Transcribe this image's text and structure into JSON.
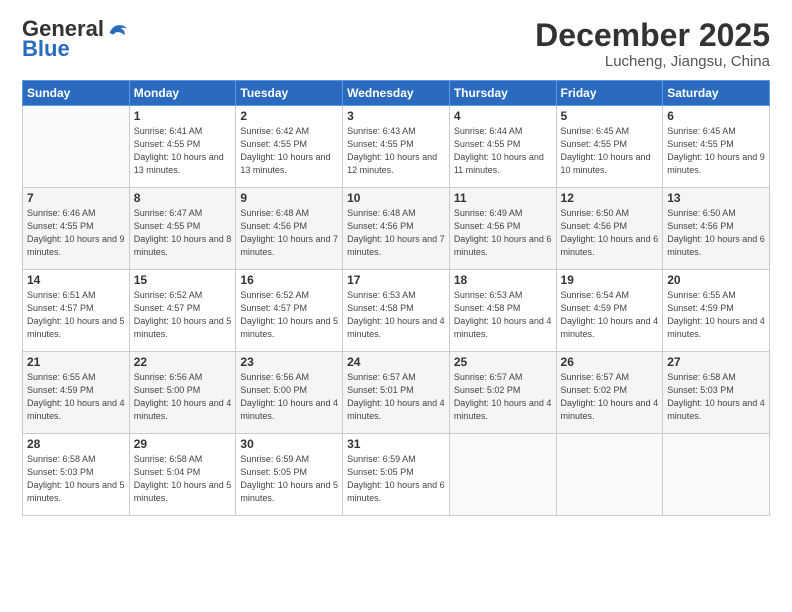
{
  "logo": {
    "general": "General",
    "blue": "Blue"
  },
  "title": "December 2025",
  "location": "Lucheng, Jiangsu, China",
  "weekdays": [
    "Sunday",
    "Monday",
    "Tuesday",
    "Wednesday",
    "Thursday",
    "Friday",
    "Saturday"
  ],
  "weeks": [
    [
      {
        "num": "",
        "sunrise": "",
        "sunset": "",
        "daylight": "",
        "empty": true
      },
      {
        "num": "1",
        "sunrise": "Sunrise: 6:41 AM",
        "sunset": "Sunset: 4:55 PM",
        "daylight": "Daylight: 10 hours and 13 minutes."
      },
      {
        "num": "2",
        "sunrise": "Sunrise: 6:42 AM",
        "sunset": "Sunset: 4:55 PM",
        "daylight": "Daylight: 10 hours and 13 minutes."
      },
      {
        "num": "3",
        "sunrise": "Sunrise: 6:43 AM",
        "sunset": "Sunset: 4:55 PM",
        "daylight": "Daylight: 10 hours and 12 minutes."
      },
      {
        "num": "4",
        "sunrise": "Sunrise: 6:44 AM",
        "sunset": "Sunset: 4:55 PM",
        "daylight": "Daylight: 10 hours and 11 minutes."
      },
      {
        "num": "5",
        "sunrise": "Sunrise: 6:45 AM",
        "sunset": "Sunset: 4:55 PM",
        "daylight": "Daylight: 10 hours and 10 minutes."
      },
      {
        "num": "6",
        "sunrise": "Sunrise: 6:45 AM",
        "sunset": "Sunset: 4:55 PM",
        "daylight": "Daylight: 10 hours and 9 minutes."
      }
    ],
    [
      {
        "num": "7",
        "sunrise": "Sunrise: 6:46 AM",
        "sunset": "Sunset: 4:55 PM",
        "daylight": "Daylight: 10 hours and 9 minutes."
      },
      {
        "num": "8",
        "sunrise": "Sunrise: 6:47 AM",
        "sunset": "Sunset: 4:55 PM",
        "daylight": "Daylight: 10 hours and 8 minutes."
      },
      {
        "num": "9",
        "sunrise": "Sunrise: 6:48 AM",
        "sunset": "Sunset: 4:56 PM",
        "daylight": "Daylight: 10 hours and 7 minutes."
      },
      {
        "num": "10",
        "sunrise": "Sunrise: 6:48 AM",
        "sunset": "Sunset: 4:56 PM",
        "daylight": "Daylight: 10 hours and 7 minutes."
      },
      {
        "num": "11",
        "sunrise": "Sunrise: 6:49 AM",
        "sunset": "Sunset: 4:56 PM",
        "daylight": "Daylight: 10 hours and 6 minutes."
      },
      {
        "num": "12",
        "sunrise": "Sunrise: 6:50 AM",
        "sunset": "Sunset: 4:56 PM",
        "daylight": "Daylight: 10 hours and 6 minutes."
      },
      {
        "num": "13",
        "sunrise": "Sunrise: 6:50 AM",
        "sunset": "Sunset: 4:56 PM",
        "daylight": "Daylight: 10 hours and 6 minutes."
      }
    ],
    [
      {
        "num": "14",
        "sunrise": "Sunrise: 6:51 AM",
        "sunset": "Sunset: 4:57 PM",
        "daylight": "Daylight: 10 hours and 5 minutes."
      },
      {
        "num": "15",
        "sunrise": "Sunrise: 6:52 AM",
        "sunset": "Sunset: 4:57 PM",
        "daylight": "Daylight: 10 hours and 5 minutes."
      },
      {
        "num": "16",
        "sunrise": "Sunrise: 6:52 AM",
        "sunset": "Sunset: 4:57 PM",
        "daylight": "Daylight: 10 hours and 5 minutes."
      },
      {
        "num": "17",
        "sunrise": "Sunrise: 6:53 AM",
        "sunset": "Sunset: 4:58 PM",
        "daylight": "Daylight: 10 hours and 4 minutes."
      },
      {
        "num": "18",
        "sunrise": "Sunrise: 6:53 AM",
        "sunset": "Sunset: 4:58 PM",
        "daylight": "Daylight: 10 hours and 4 minutes."
      },
      {
        "num": "19",
        "sunrise": "Sunrise: 6:54 AM",
        "sunset": "Sunset: 4:59 PM",
        "daylight": "Daylight: 10 hours and 4 minutes."
      },
      {
        "num": "20",
        "sunrise": "Sunrise: 6:55 AM",
        "sunset": "Sunset: 4:59 PM",
        "daylight": "Daylight: 10 hours and 4 minutes."
      }
    ],
    [
      {
        "num": "21",
        "sunrise": "Sunrise: 6:55 AM",
        "sunset": "Sunset: 4:59 PM",
        "daylight": "Daylight: 10 hours and 4 minutes."
      },
      {
        "num": "22",
        "sunrise": "Sunrise: 6:56 AM",
        "sunset": "Sunset: 5:00 PM",
        "daylight": "Daylight: 10 hours and 4 minutes."
      },
      {
        "num": "23",
        "sunrise": "Sunrise: 6:56 AM",
        "sunset": "Sunset: 5:00 PM",
        "daylight": "Daylight: 10 hours and 4 minutes."
      },
      {
        "num": "24",
        "sunrise": "Sunrise: 6:57 AM",
        "sunset": "Sunset: 5:01 PM",
        "daylight": "Daylight: 10 hours and 4 minutes."
      },
      {
        "num": "25",
        "sunrise": "Sunrise: 6:57 AM",
        "sunset": "Sunset: 5:02 PM",
        "daylight": "Daylight: 10 hours and 4 minutes."
      },
      {
        "num": "26",
        "sunrise": "Sunrise: 6:57 AM",
        "sunset": "Sunset: 5:02 PM",
        "daylight": "Daylight: 10 hours and 4 minutes."
      },
      {
        "num": "27",
        "sunrise": "Sunrise: 6:58 AM",
        "sunset": "Sunset: 5:03 PM",
        "daylight": "Daylight: 10 hours and 4 minutes."
      }
    ],
    [
      {
        "num": "28",
        "sunrise": "Sunrise: 6:58 AM",
        "sunset": "Sunset: 5:03 PM",
        "daylight": "Daylight: 10 hours and 5 minutes."
      },
      {
        "num": "29",
        "sunrise": "Sunrise: 6:58 AM",
        "sunset": "Sunset: 5:04 PM",
        "daylight": "Daylight: 10 hours and 5 minutes."
      },
      {
        "num": "30",
        "sunrise": "Sunrise: 6:59 AM",
        "sunset": "Sunset: 5:05 PM",
        "daylight": "Daylight: 10 hours and 5 minutes."
      },
      {
        "num": "31",
        "sunrise": "Sunrise: 6:59 AM",
        "sunset": "Sunset: 5:05 PM",
        "daylight": "Daylight: 10 hours and 6 minutes."
      },
      {
        "num": "",
        "sunrise": "",
        "sunset": "",
        "daylight": "",
        "empty": true
      },
      {
        "num": "",
        "sunrise": "",
        "sunset": "",
        "daylight": "",
        "empty": true
      },
      {
        "num": "",
        "sunrise": "",
        "sunset": "",
        "daylight": "",
        "empty": true
      }
    ]
  ]
}
